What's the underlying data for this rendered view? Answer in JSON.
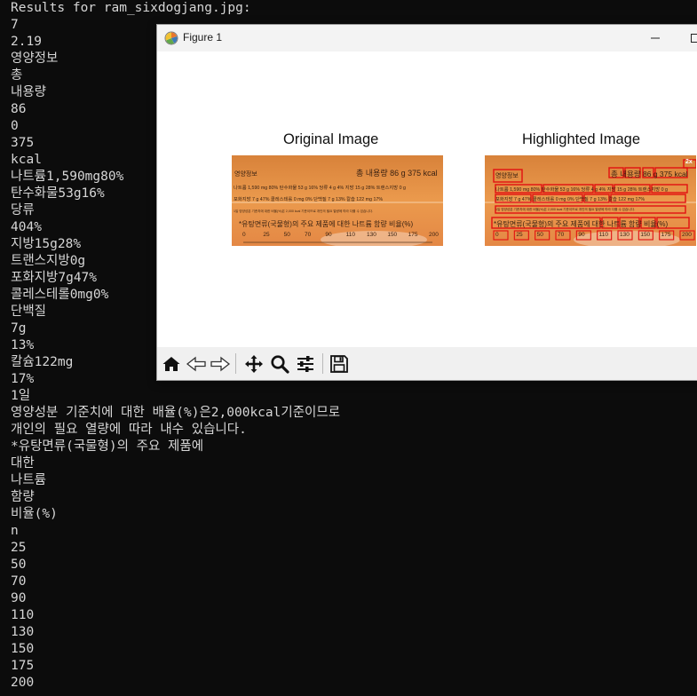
{
  "terminal": {
    "lines": [
      "Results for ram_sixdogjang.jpg:",
      "7",
      "2.19",
      "영양정보",
      "총",
      "내용량",
      "86",
      "0",
      "375",
      "kcal",
      "나트륨1,590mg80%",
      "탄수화물53g16%",
      "당류",
      "404%",
      "지방15g28%",
      "트랜스지방0g",
      "포화지방7g47%",
      "콜레스테롤0mg0%",
      "단백질",
      "7g",
      "13%",
      "칼슘122mg",
      "17%",
      "1일",
      "영양성분 기준치에 대한 배율(%)은2,000kcal기준이므로",
      "개인의 필요 열량에 따라 내수 있습니다.",
      "*유탕면류(국물형)의 주요 제품에",
      "대한",
      "나트륨",
      "함량",
      "비율(%)",
      "n",
      "25",
      "50",
      "70",
      "90",
      "110",
      "130",
      "150",
      "175",
      "200"
    ]
  },
  "figure_window": {
    "title": "Figure 1",
    "left_axes_title": "Original Image",
    "right_axes_title": "Highlighted Image",
    "label_image": {
      "header_left": "영양정보",
      "header_right": "총 내용량 86 g 375 kcal",
      "row1": "나트륨 1,590 mg 80%  탄수화물 53 g 16%  당류 4 g 4%  지방 15 g 28%  트랜스지방 0 g",
      "row2": "포화지방 7 g 47%  콜레스테롤 0 mg 0%  단백질 7 g 13%  칼슘 122 mg 17%",
      "row3": "1일 영양성분 기준치에 대한 비율(%)은 2,000 kcal 기준이므로 개인의 필요 열량에 따라 다를 수 있습니다.",
      "sodium_line": "*유탕면류(국물형)의 주요 제품에 대한 나트륨 함량 비율(%)",
      "scale": [
        "0",
        "25",
        "50",
        "70",
        "90",
        "110",
        "130",
        "150",
        "175",
        "200"
      ],
      "badge": "2x"
    },
    "toolbar": {
      "icons": [
        "home-icon",
        "back-icon",
        "forward-icon",
        "pan-icon",
        "zoom-icon",
        "configure-subplots-icon",
        "save-icon"
      ]
    },
    "colors": {
      "label_orange": "#e58a3c",
      "highlight_red": "#e21010",
      "terminal_bg": "#0c0c0c",
      "terminal_text": "#d6d6d6"
    }
  }
}
